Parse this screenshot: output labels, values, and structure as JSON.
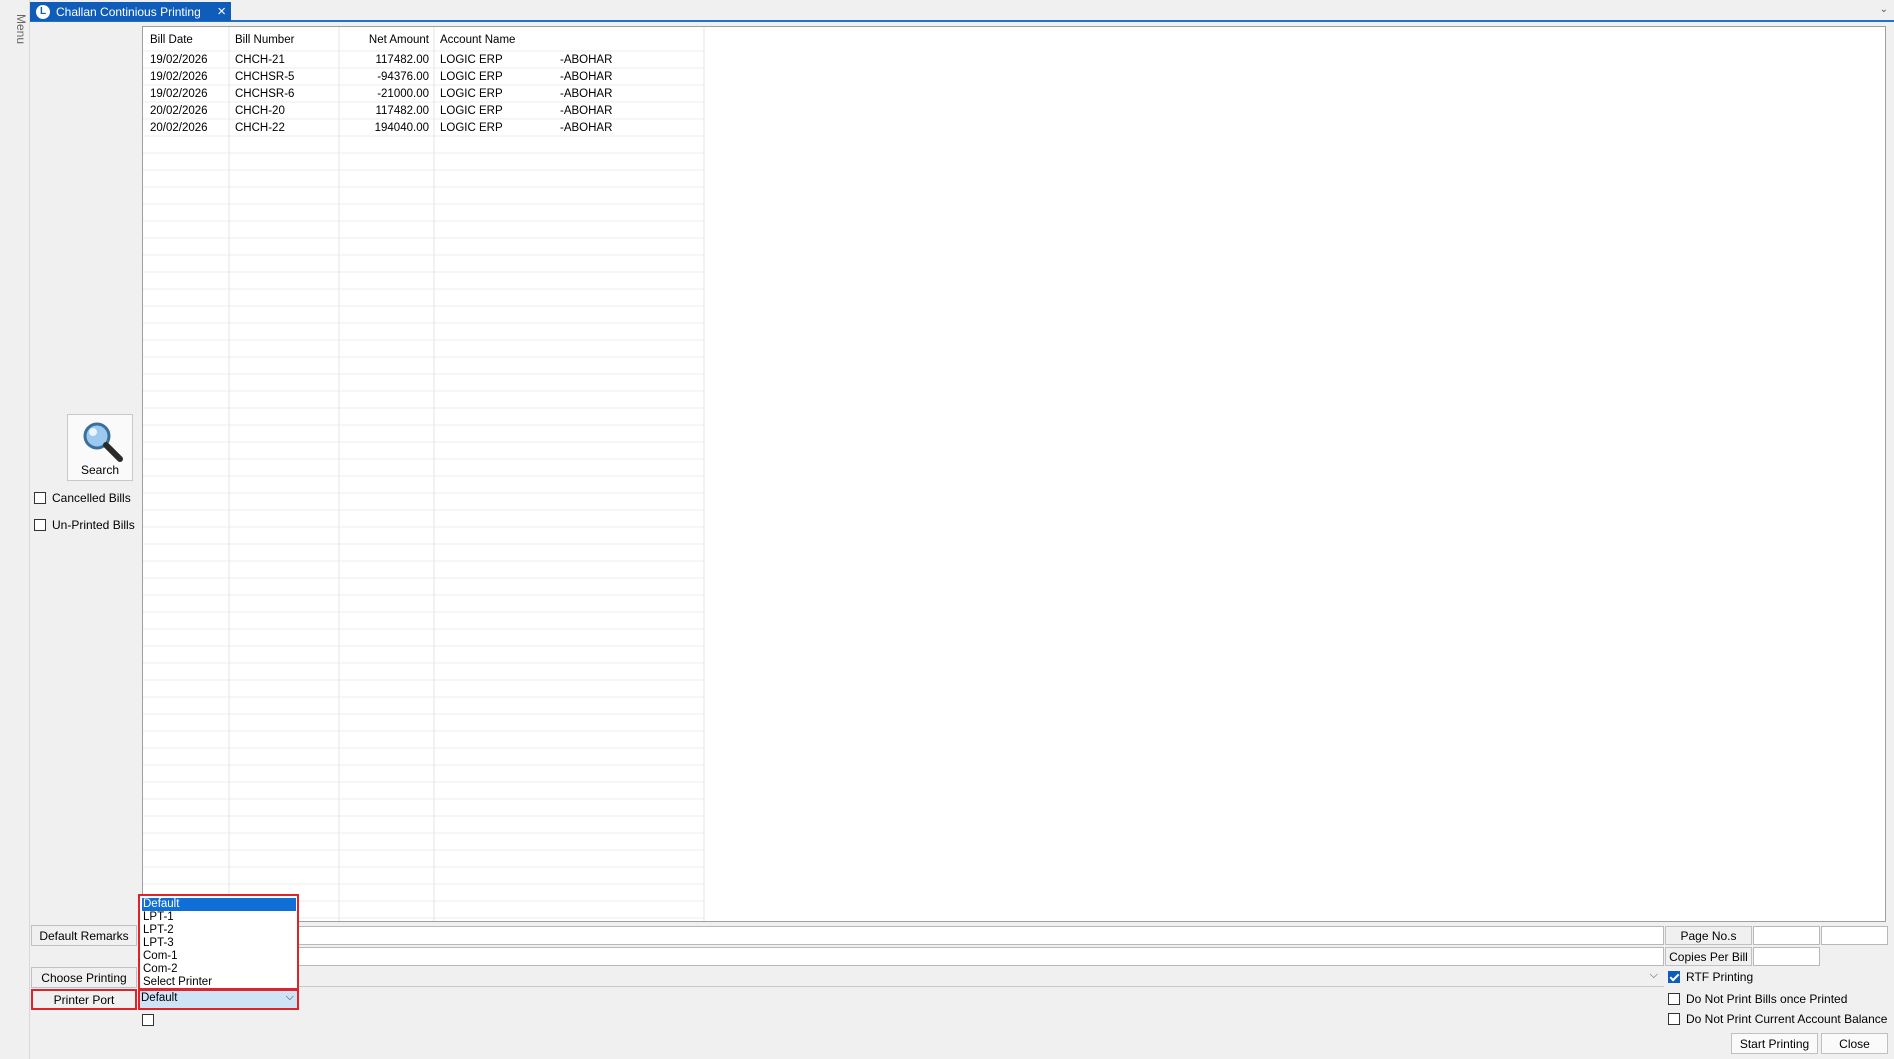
{
  "sidebar": {
    "menu_label": "Menu"
  },
  "tab": {
    "title": "Challan Continious Printing",
    "logo_letter": "L"
  },
  "table": {
    "columns": [
      "Bill Date",
      "Bill Number",
      "Net Amount",
      "Account Name"
    ],
    "rows": [
      {
        "date": "19/02/2026",
        "bill": "CHCH-21",
        "amount": "117482.00",
        "account": "LOGIC ERP",
        "city": "-ABOHAR"
      },
      {
        "date": "19/02/2026",
        "bill": "CHCHSR-5",
        "amount": "-94376.00",
        "account": "LOGIC ERP",
        "city": "-ABOHAR"
      },
      {
        "date": "19/02/2026",
        "bill": "CHCHSR-6",
        "amount": "-21000.00",
        "account": "LOGIC ERP",
        "city": "-ABOHAR"
      },
      {
        "date": "20/02/2026",
        "bill": "CHCH-20",
        "amount": "117482.00",
        "account": "LOGIC ERP",
        "city": "-ABOHAR"
      },
      {
        "date": "20/02/2026",
        "bill": "CHCH-22",
        "amount": "194040.00",
        "account": "LOGIC ERP",
        "city": "-ABOHAR"
      }
    ]
  },
  "filters": {
    "search_label": "Search",
    "cancelled_label": "Cancelled Bills",
    "unprinted_label": "Un-Printed Bills"
  },
  "form": {
    "default_remarks_label": "Default Remarks",
    "choose_printing_label": "Choose Printing",
    "printer_port_label": "Printer Port",
    "printer_port_value": "Default",
    "page_nos_label": "Page No.s",
    "copies_per_bill_label": "Copies Per Bill",
    "rtf_printing_label": "RTF Printing",
    "rtf_printing_checked": true,
    "no_print_once_label": "Do Not Print Bills once Printed",
    "no_print_balance_label": "Do Not Print Current Account Balance",
    "start_printing_label": "Start Printing",
    "close_label": "Close"
  },
  "dropdown": {
    "options": [
      "Default",
      "LPT-1",
      "LPT-2",
      "LPT-3",
      "Com-1",
      "Com-2",
      "Select Printer"
    ],
    "selected": "Default"
  },
  "colors": {
    "accent": "#0f5db8",
    "highlight": "#e0232b",
    "selection": "#0f6fd6"
  }
}
